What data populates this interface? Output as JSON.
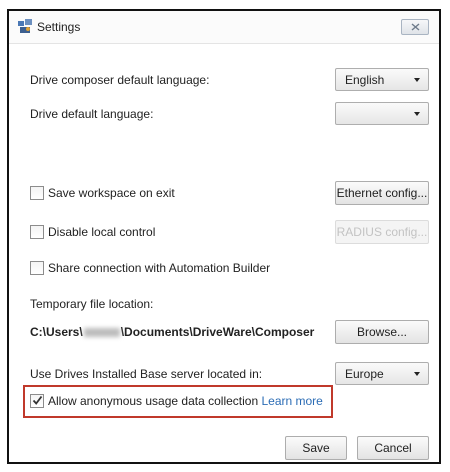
{
  "window": {
    "title": "Settings",
    "close_icon": "close-icon"
  },
  "composer_language": {
    "label": "Drive composer default language:",
    "value": "English"
  },
  "drive_language": {
    "label": "Drive default language:",
    "value": ""
  },
  "save_workspace": {
    "label": "Save workspace on exit",
    "checked": false
  },
  "ethernet_button": "Ethernet config...",
  "disable_local": {
    "label": "Disable local control",
    "checked": false
  },
  "radius_button": "RADIUS config...",
  "share_connection": {
    "label": "Share connection with Automation Builder",
    "checked": false
  },
  "temp_file": {
    "label": "Temporary file location:",
    "path_prefix": "C:\\Users\\",
    "path_suffix": "\\Documents\\DriveWare\\Composer",
    "browse_button": "Browse..."
  },
  "server": {
    "label": "Use Drives Installed Base server located in:",
    "value": "Europe"
  },
  "usage_data": {
    "label": "Allow anonymous usage data collection",
    "link": "Learn more",
    "checked": true
  },
  "footer": {
    "save": "Save",
    "cancel": "Cancel"
  },
  "colors": {
    "highlight": "#c0392b",
    "link": "#2b6cb5"
  }
}
